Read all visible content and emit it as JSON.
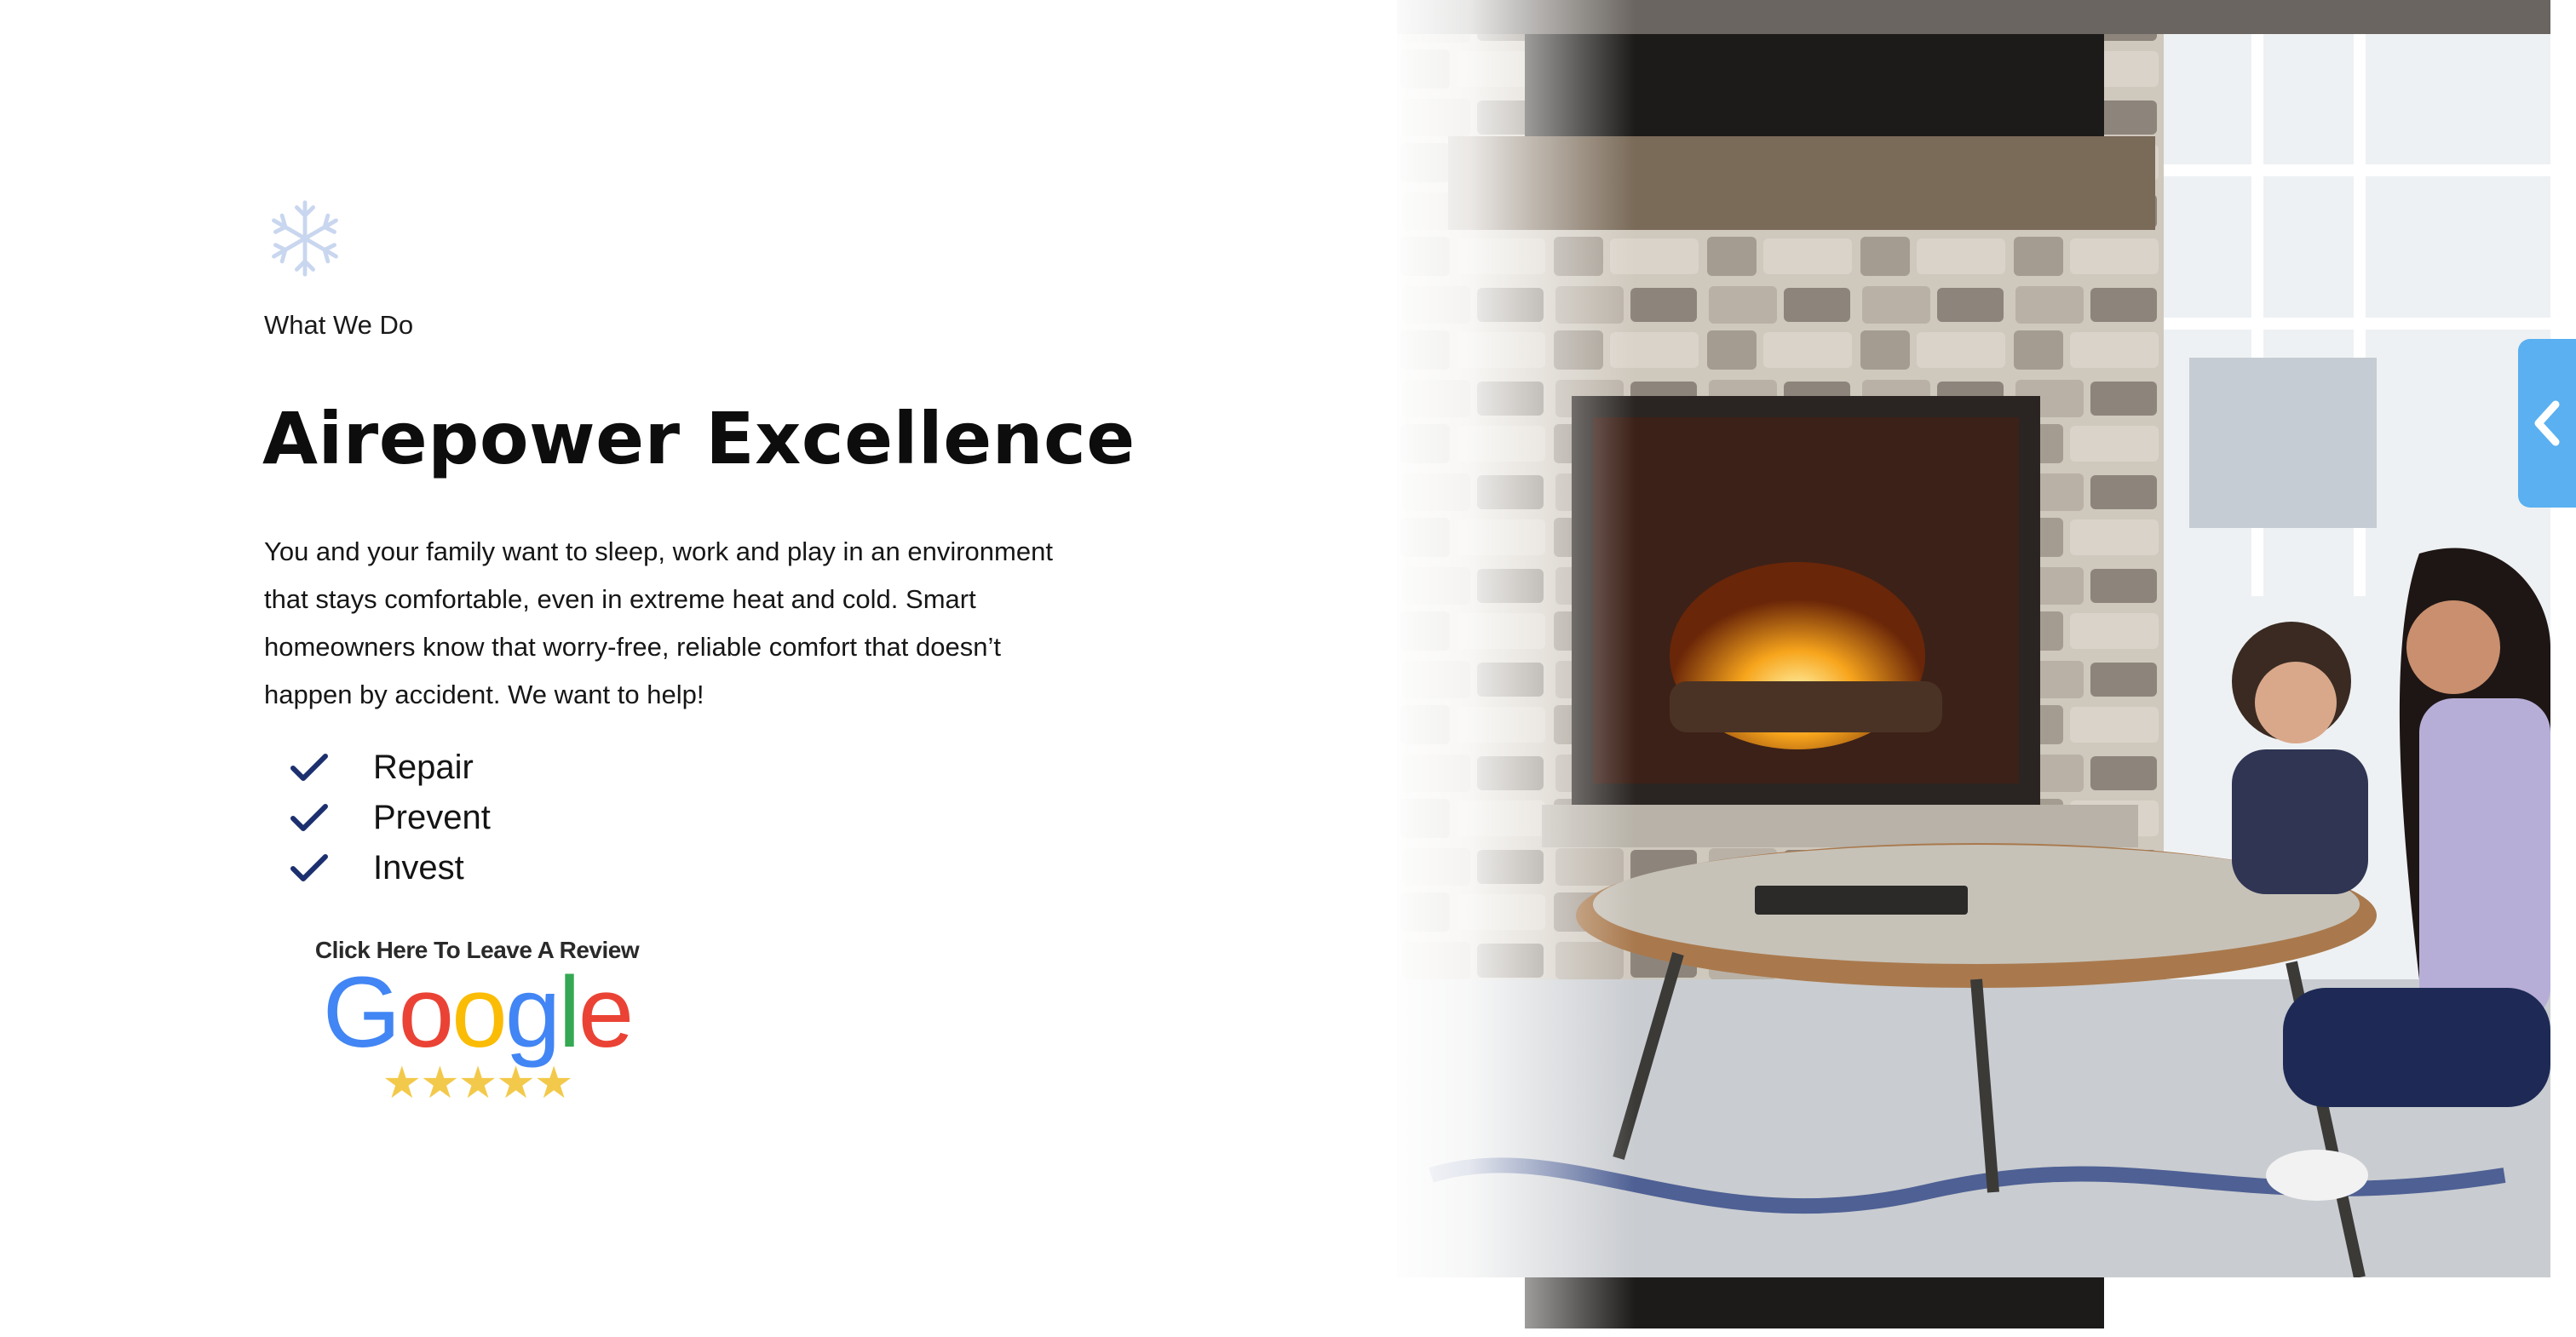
{
  "section": {
    "icon": "snowflake-icon",
    "eyebrow": "What We Do",
    "title": "Airepower Excellence",
    "body": "You and your family want to sleep, work and play in an environment that stays comfortable, even in extreme heat and cold. Smart homeowners know that worry-free, reliable comfort that doesn’t happen by accident. We want to help!",
    "checklist": [
      "Repair",
      "Prevent",
      "Invest"
    ]
  },
  "review": {
    "caption": "Click Here To Leave A Review",
    "brand": "Google",
    "stars": "★★★★★",
    "brand_colors": [
      "#4285F4",
      "#EA4335",
      "#FBBC05",
      "#4285F4",
      "#34A853",
      "#EA4335"
    ],
    "star_color": "#f3c94b"
  },
  "hero_image": {
    "description_icon": "fireplace-photo"
  },
  "side_tab": {
    "icon": "chevron-left-icon",
    "color": "#5ab0f0"
  },
  "colors": {
    "check_color": "#1c2f6e",
    "snowflake_color": "#c9d6ef"
  }
}
